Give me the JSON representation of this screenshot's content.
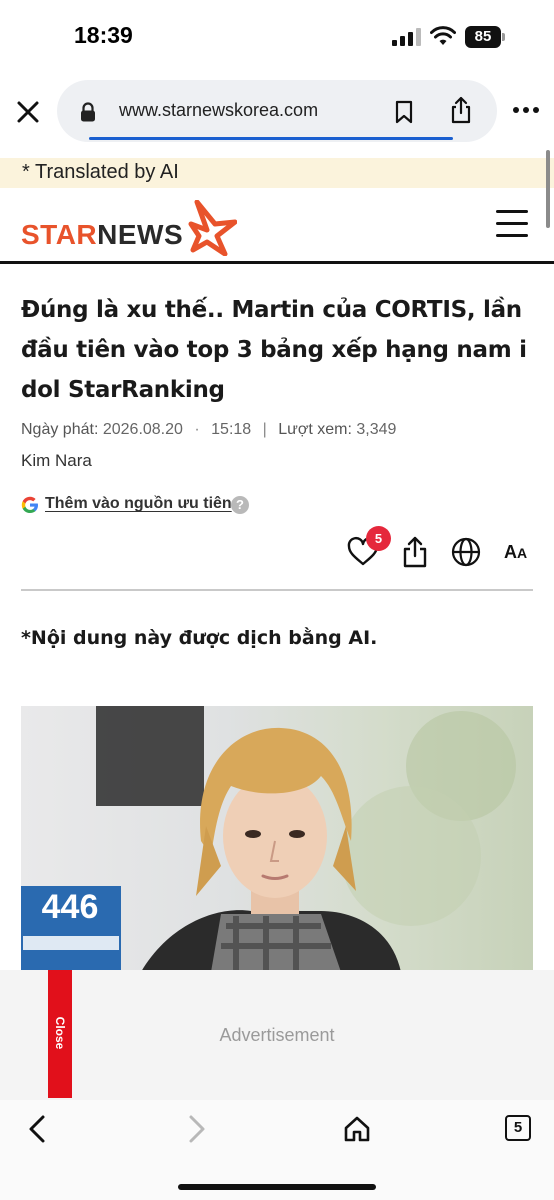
{
  "status_bar": {
    "time": "18:39",
    "battery": "85"
  },
  "browser": {
    "url": "www.starnewskorea.com",
    "url_underline_color": "#1a5fd0",
    "icons": [
      "close-icon",
      "lock-icon",
      "bookmark-icon",
      "share-icon",
      "more-icon"
    ]
  },
  "translation_banner": {
    "text": "* Translated by AI",
    "bg_color": "#fbf3dc"
  },
  "header": {
    "logo_part1": "STAR",
    "logo_part2": "NEWS",
    "brand_color": "#e8532b",
    "menu_icon": "hamburger-icon"
  },
  "article": {
    "title": "Đúng là xu thế.. Martin của CORTIS, lần đầu tiên vào top 3 bảng xếp hạng nam idol StarRanking",
    "meta": {
      "date_label": "Ngày phát:",
      "date": "2026.08.20",
      "time": "15:18",
      "views_label": "Lượt xem:",
      "views": "3,349"
    },
    "author": "Kim Nara",
    "google_pref": "Thêm vào nguồn ưu tiên",
    "help_symbol": "?",
    "like_count": "5",
    "font_size_label_big": "A",
    "font_size_label_small": "A",
    "ai_note": "*Nội dung này được dịch bằng AI.",
    "photo_sign": "446"
  },
  "ad": {
    "close_label": "Close",
    "label": "Advertisement"
  },
  "bottom_toolbar": {
    "tabs_count": "5",
    "icons": [
      "back-icon",
      "forward-icon",
      "home-icon",
      "tabs-icon"
    ]
  }
}
